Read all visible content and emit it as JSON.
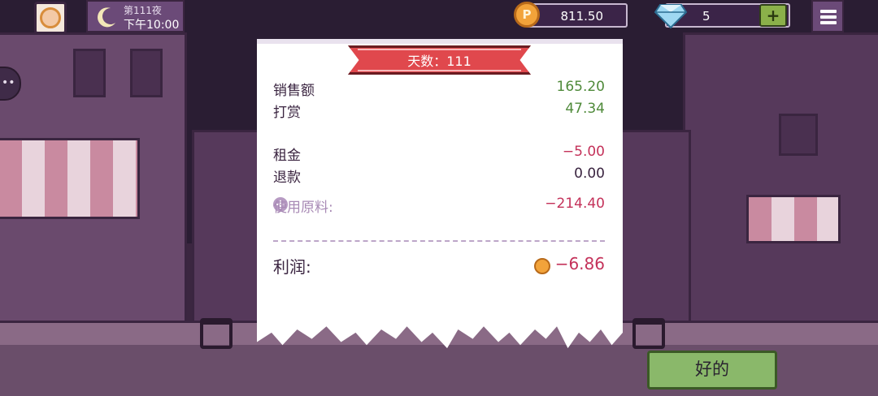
{
  "hud": {
    "day_label": "第111夜",
    "clock": "下午10:00",
    "coins": "811.50",
    "gems": "5",
    "plus_label": "+"
  },
  "receipt": {
    "banner": "天数：111",
    "rows": [
      {
        "label": "销售额",
        "amount": "165.20"
      },
      {
        "label": "打赏",
        "amount": "47.34"
      },
      {
        "label": "租金",
        "amount": "−5.00"
      },
      {
        "label": "退款",
        "amount": "0.00"
      }
    ],
    "ingredients": {
      "label": "使用原料:",
      "amount": "−214.40"
    },
    "profit": {
      "label": "利润:",
      "amount": "−6.86"
    }
  },
  "ok_button": "好的",
  "colors": {
    "positive": "#4f8a3a",
    "negative": "#c4325a",
    "banner": "#e0484d",
    "ok_button": "#8ab86a"
  }
}
